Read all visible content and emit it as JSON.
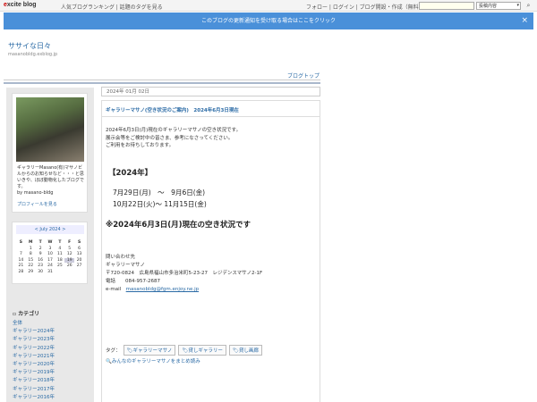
{
  "topbar": {
    "logo_prefix": "e",
    "logo_rest": "xcite blog",
    "links": "人気ブログランキング | 話題のタグを見る",
    "right_links": "フォロー | ログイン | ブログ開設・作成（無料）",
    "search_placeholder": "",
    "search_scope": "投稿内容"
  },
  "notify": {
    "text": "このブログの更新通知を受け取る場合はここをクリック",
    "close": "×"
  },
  "blog": {
    "title": "ササイな日々",
    "url": "masanobldg.exblog.jp",
    "top_link": "ブログトップ"
  },
  "profile": {
    "text": "ギャラリーMasano(有)マサノビルからのお知らせなど・・・と思いきや、ほぼ動物化したブログです。",
    "by": "by masano-bldg",
    "link": "プロフィールを見る"
  },
  "calendar": {
    "header": "< July 2024 >",
    "days": [
      "S",
      "M",
      "T",
      "W",
      "T",
      "F",
      "S"
    ],
    "cells": [
      "",
      "1",
      "2",
      "3",
      "4",
      "5",
      "6",
      "7",
      "8",
      "9",
      "10",
      "11",
      "12",
      "13",
      "14",
      "15",
      "16",
      "17",
      "18",
      "19",
      "20",
      "21",
      "22",
      "23",
      "24",
      "25",
      "26",
      "27",
      "28",
      "29",
      "30",
      "31",
      "",
      "",
      ""
    ],
    "today": "19"
  },
  "categories": {
    "title": "カテゴリ",
    "items": [
      "全体",
      "ギャラリー2024年",
      "ギャラリー2023年",
      "ギャラリー2022年",
      "ギャラリー2021年",
      "ギャラリー2020年",
      "ギャラリー2019年",
      "ギャラリー2018年",
      "ギャラリー2017年",
      "ギャラリー2016年"
    ]
  },
  "post": {
    "date": "2024年 01月 02日",
    "title": "ギャラリーマサノ(空き状況のご案内)　2024年6月3日現在",
    "intro_1": "2024年6月3日(月)現在のギャラリーマサノの空き状況です。",
    "intro_2": "展示会等をご検討中の皆さま、参考になさってください。",
    "intro_3": "ご利用をお待ちしております。",
    "heading": "【2024年】",
    "date_1": "7月29日(月)　～　9月6日(金)",
    "date_2": "10月22日(火)～ 11月15日(金)",
    "status": "※2024年6月3日(月)現在の空き状況です",
    "contact_1": "問い合わせ先",
    "contact_2": "ギャラリーマサノ",
    "contact_3": "〒720-0824　広島県福山市多治米町5-23-27　レジデンスマサノ2-1F",
    "contact_4": "電話　　084-957-2687",
    "contact_5_label": "e-mail　",
    "contact_5_value": "masanobldg@fgm.enjoy.ne.jp",
    "tags_label": "タグ：",
    "tags": [
      "ギャラリーマサノ",
      "貸しギャラリー",
      "貸し画廊"
    ],
    "tag_all": "みんなのギャラリーマサノをまとめ読み"
  },
  "colors": {
    "accent": "#2a6aa5",
    "notify_bg": "#4a90d9"
  }
}
